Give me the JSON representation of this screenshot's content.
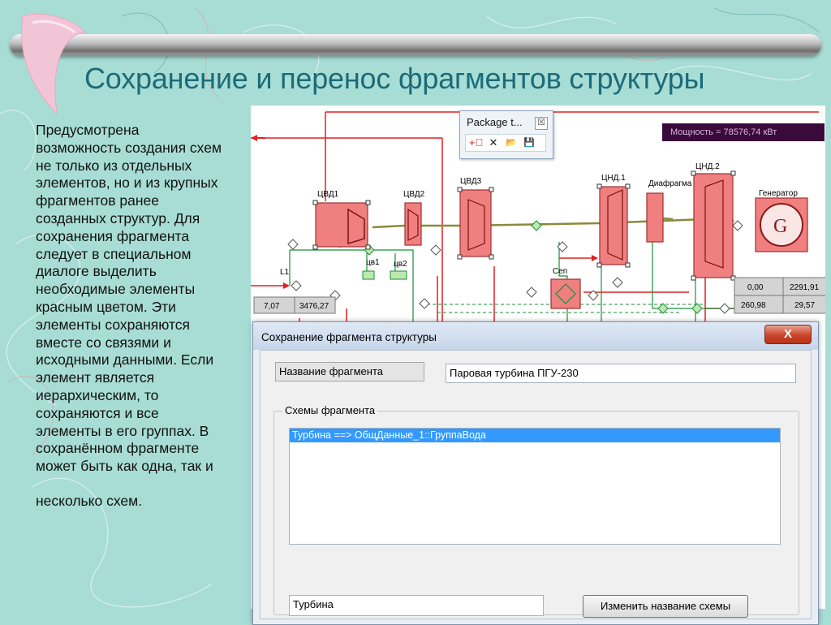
{
  "title": "Сохранение и перенос фрагментов структуры",
  "body": {
    "lines": [
      "Предусмотрена",
      "возможность создания схем",
      "не только из отдельных",
      "элементов, но и из крупных",
      "фрагментов ранее",
      "созданных структур. Для",
      "сохранения фрагмента",
      "следует в специальном",
      "диалоге  выделить",
      "необходимые элементы",
      "красным цветом. Эти",
      "элементы сохраняются",
      "вместе со связями и",
      "исходными данными. Если",
      "элемент является",
      "иерархическим, то",
      "сохраняются и все",
      "элементы в его группах. В",
      "сохранённом фрагменте",
      "может быть как одна, так и"
    ],
    "last_line": "несколько схем."
  },
  "schema": {
    "labels": {
      "cvd1": "ЦВД1",
      "cvd2": "ЦВД2",
      "cvd3": "ЦВД3",
      "cnd1": "ЦНД.1",
      "cnd2": "ЦНД.2",
      "diafragma": "Диафрагма",
      "generator": "Генератор",
      "gen_symbol": "G",
      "l1": "L1",
      "cv1": "цв1",
      "cv2": "цв2",
      "sep": "Сеп"
    },
    "power": {
      "label": "Мощность",
      "eq": "=",
      "value": "78576,74",
      "unit": "кВт"
    },
    "cells": {
      "a": "7,07",
      "b": "3476,27",
      "c": "0,00",
      "d": "2291,91",
      "e": "260,98",
      "f": "29,57"
    }
  },
  "package": {
    "title": "Package t...",
    "close": "☒",
    "tools": [
      "+⃓",
      "✕",
      "📂",
      "💾"
    ]
  },
  "dialog": {
    "title": "Сохранение фрагмента структуры",
    "close": "X",
    "name_label": "Название фрагмента",
    "name_value": "Паровая турбина ПГУ-230",
    "group_label": "Схемы фрагмента",
    "list_items": [
      "Турбина ==> ОбщДанные_1::ГруппаВода"
    ],
    "scheme_name": "Турбина",
    "rename_button": "Изменить название схемы"
  },
  "colors": {
    "title": "#1c6b78",
    "selection": "#3399ff",
    "element_fill": "#f08080",
    "wire_red": "#e02020",
    "wire_olive": "#8a8a3c",
    "wire_green": "#1a8f3a"
  }
}
